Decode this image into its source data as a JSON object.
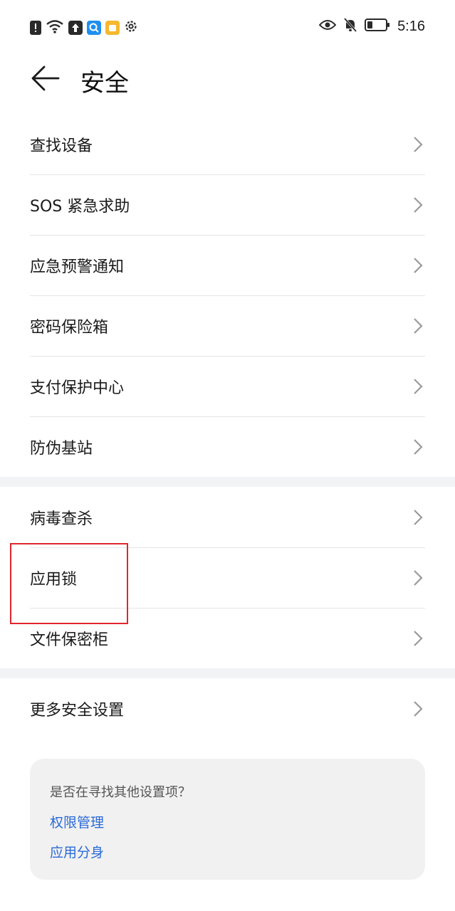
{
  "status_bar": {
    "time": "5:16",
    "left_icons": [
      "alert-icon",
      "wifi-icon",
      "upload-icon",
      "search-app-icon",
      "note-app-icon",
      "gear-icon"
    ],
    "right_icons": [
      "eye-icon",
      "bell-off-icon",
      "battery-icon"
    ]
  },
  "header": {
    "title": "安全"
  },
  "groups": [
    {
      "items": [
        "查找设备",
        "SOS 紧急求助",
        "应急预警通知",
        "密码保险箱",
        "支付保护中心",
        "防伪基站"
      ]
    },
    {
      "items": [
        "病毒查杀",
        "应用锁",
        "文件保密柜"
      ]
    },
    {
      "items": [
        "更多安全设置"
      ]
    }
  ],
  "suggestion": {
    "question": "是否在寻找其他设置项？",
    "links": [
      "权限管理",
      "应用分身"
    ]
  },
  "colors": {
    "accent_link": "#2a6ad8",
    "highlight_border": "#e0262e",
    "separator": "#f1f3f5"
  }
}
